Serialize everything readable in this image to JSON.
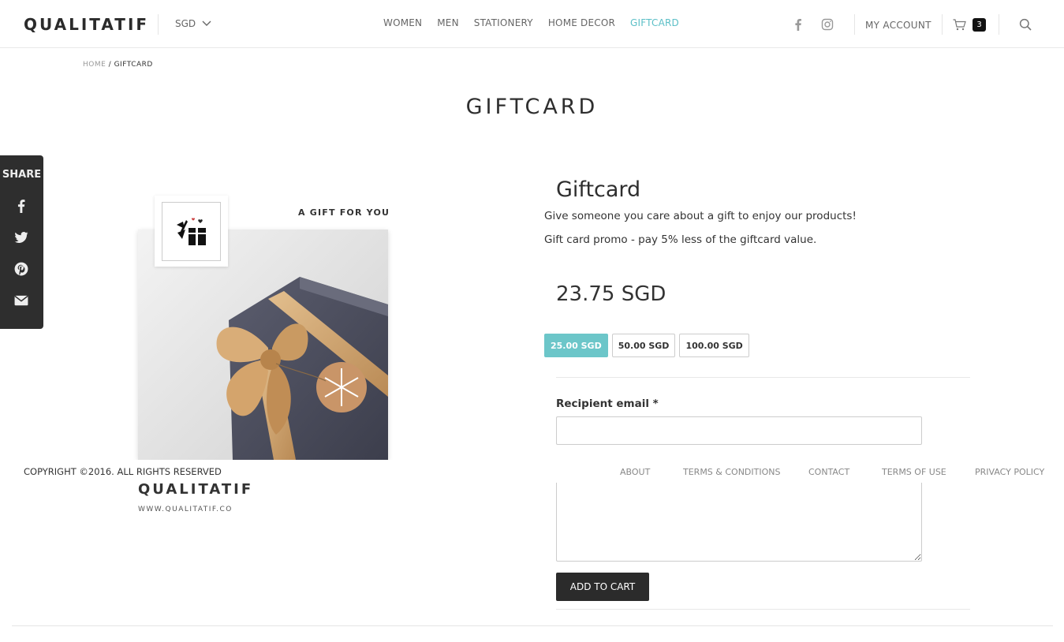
{
  "header": {
    "logo": "QUALITATIF",
    "currency": "SGD",
    "nav": [
      {
        "label": "WOMEN"
      },
      {
        "label": "MEN"
      },
      {
        "label": "STATIONERY"
      },
      {
        "label": "HOME DECOR"
      },
      {
        "label": "GIFTCARD",
        "active": true
      }
    ],
    "my_account": "MY ACCOUNT",
    "cart_count": "3",
    "icons": [
      "facebook-icon",
      "instagram-icon",
      "cart-icon",
      "search-icon"
    ],
    "active_color": "#5cbfc7"
  },
  "breadcrumb": {
    "home": "HOME",
    "separator": " / ",
    "current": "GIFTCARD"
  },
  "page_title": "GIFTCARD",
  "share": {
    "label": "SHARE",
    "icons": [
      "facebook-icon",
      "twitter-icon",
      "pinterest-icon",
      "email-icon"
    ]
  },
  "product_image": {
    "caption": "A GIFT FOR YOU",
    "brand": "QUALITATIF",
    "url": "WWW.QUALITATIF.CO"
  },
  "product": {
    "name": "Giftcard",
    "description_1": "Give someone you care about a gift to enjoy our products!",
    "description_2": "Gift card promo - pay 5% less of the giftcard value.",
    "price": "23.75 SGD",
    "variants": [
      {
        "label": "25.00 SGD",
        "selected": true
      },
      {
        "label": "50.00 SGD",
        "selected": false
      },
      {
        "label": "100.00 SGD",
        "selected": false
      }
    ],
    "recipient_email_label": "Recipient email *",
    "recipient_email_value": "",
    "message_value": "",
    "add_to_cart": "ADD TO CART",
    "selected_color": "#6cc6c9"
  },
  "footer": {
    "copyright": "COPYRIGHT ©2016. ALL RIGHTS RESERVED",
    "links": [
      "ABOUT",
      "TERMS & CONDITIONS",
      "CONTACT",
      "TERMS OF USE",
      "PRIVACY POLICY"
    ]
  }
}
